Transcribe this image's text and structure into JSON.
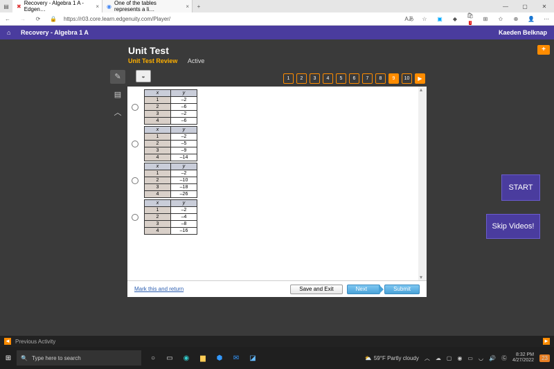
{
  "browser": {
    "tabs": [
      {
        "title": "Recovery - Algebra 1 A - Edgen…"
      },
      {
        "title": "One of the tables represents a li…"
      }
    ],
    "url": "https://r03.core.learn.edgenuity.com/Player/"
  },
  "app": {
    "breadcrumb": "Recovery - Algebra 1 A",
    "student": "Kaeden Belknap"
  },
  "lesson": {
    "title": "Unit Test",
    "subtitle_review": "Unit Test Review",
    "subtitle_active": "Active",
    "questions": [
      "1",
      "2",
      "3",
      "4",
      "5",
      "6",
      "7",
      "8",
      "9",
      "10"
    ],
    "current_q": 9
  },
  "footer": {
    "mark": "Mark this and return",
    "save": "Save and Exit",
    "next": "Next",
    "submit": "Submit"
  },
  "floating": {
    "start": "START",
    "skip": "Skip Videos!"
  },
  "prev_activity": "Previous Activity",
  "chart_data": [
    {
      "type": "table",
      "headers": [
        "x",
        "y"
      ],
      "rows": [
        [
          1,
          -2
        ],
        [
          2,
          -6
        ],
        [
          3,
          -2
        ],
        [
          4,
          -6
        ]
      ]
    },
    {
      "type": "table",
      "headers": [
        "x",
        "y"
      ],
      "rows": [
        [
          1,
          -2
        ],
        [
          2,
          -5
        ],
        [
          3,
          -9
        ],
        [
          4,
          -14
        ]
      ]
    },
    {
      "type": "table",
      "headers": [
        "x",
        "y"
      ],
      "rows": [
        [
          1,
          -2
        ],
        [
          2,
          -10
        ],
        [
          3,
          -18
        ],
        [
          4,
          -26
        ]
      ]
    },
    {
      "type": "table",
      "headers": [
        "x",
        "y"
      ],
      "rows": [
        [
          1,
          -2
        ],
        [
          2,
          -4
        ],
        [
          3,
          -8
        ],
        [
          4,
          -16
        ]
      ]
    }
  ],
  "taskbar": {
    "search_placeholder": "Type here to search",
    "weather": "59°F  Partly cloudy",
    "time": "8:32 PM",
    "date": "4/27/2022",
    "notif": "23"
  }
}
